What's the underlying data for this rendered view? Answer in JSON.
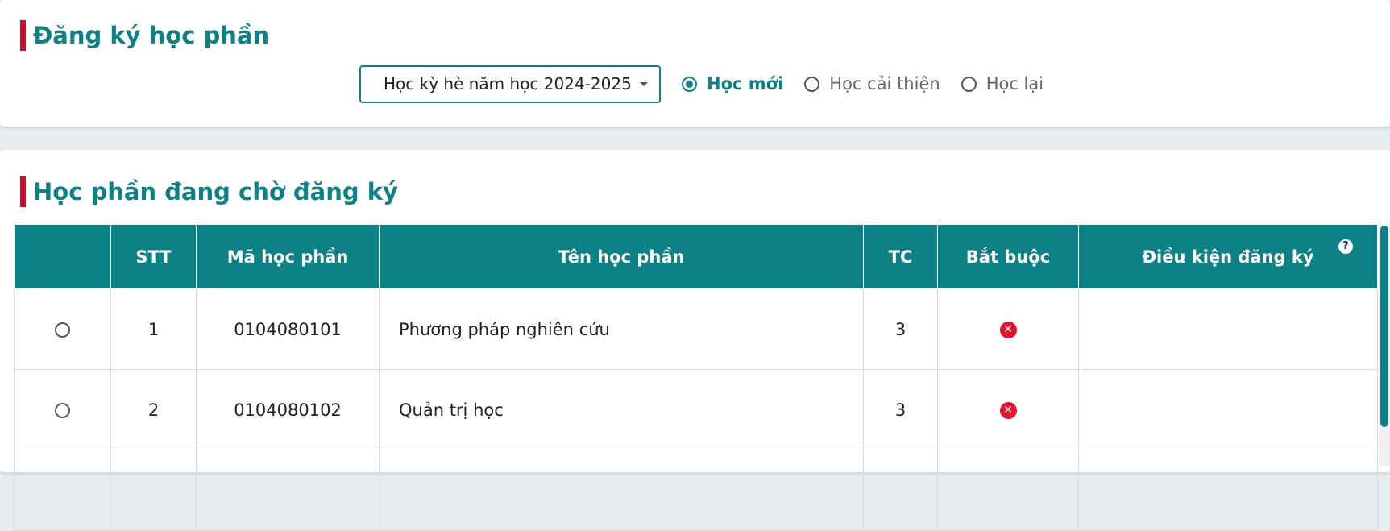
{
  "register": {
    "title": "Đăng ký học phần",
    "semester_select": {
      "value": "Học kỳ hè năm học 2024-2025"
    },
    "options": [
      {
        "label": "Học mới",
        "selected": true
      },
      {
        "label": "Học cải thiện",
        "selected": false
      },
      {
        "label": "Học lại",
        "selected": false
      }
    ]
  },
  "pending": {
    "title": "Học phần đang chờ đăng ký",
    "columns": [
      "",
      "STT",
      "Mã học phần",
      "Tên học phần",
      "TC",
      "Bắt buộc",
      "Điều kiện đăng ký"
    ],
    "rows": [
      {
        "stt": "1",
        "code": "0104080101",
        "name": "Phương pháp nghiên cứu",
        "tc": "3",
        "required": false,
        "condition": ""
      },
      {
        "stt": "2",
        "code": "0104080102",
        "name": "Quản trị học",
        "tc": "3",
        "required": false,
        "condition": ""
      }
    ]
  },
  "icons": {
    "help": "help-icon",
    "not_required": "x-circle-icon"
  },
  "colors": {
    "accent": "#0c8186",
    "title_bar": "#c8102e",
    "false_icon": "#e8102a"
  }
}
